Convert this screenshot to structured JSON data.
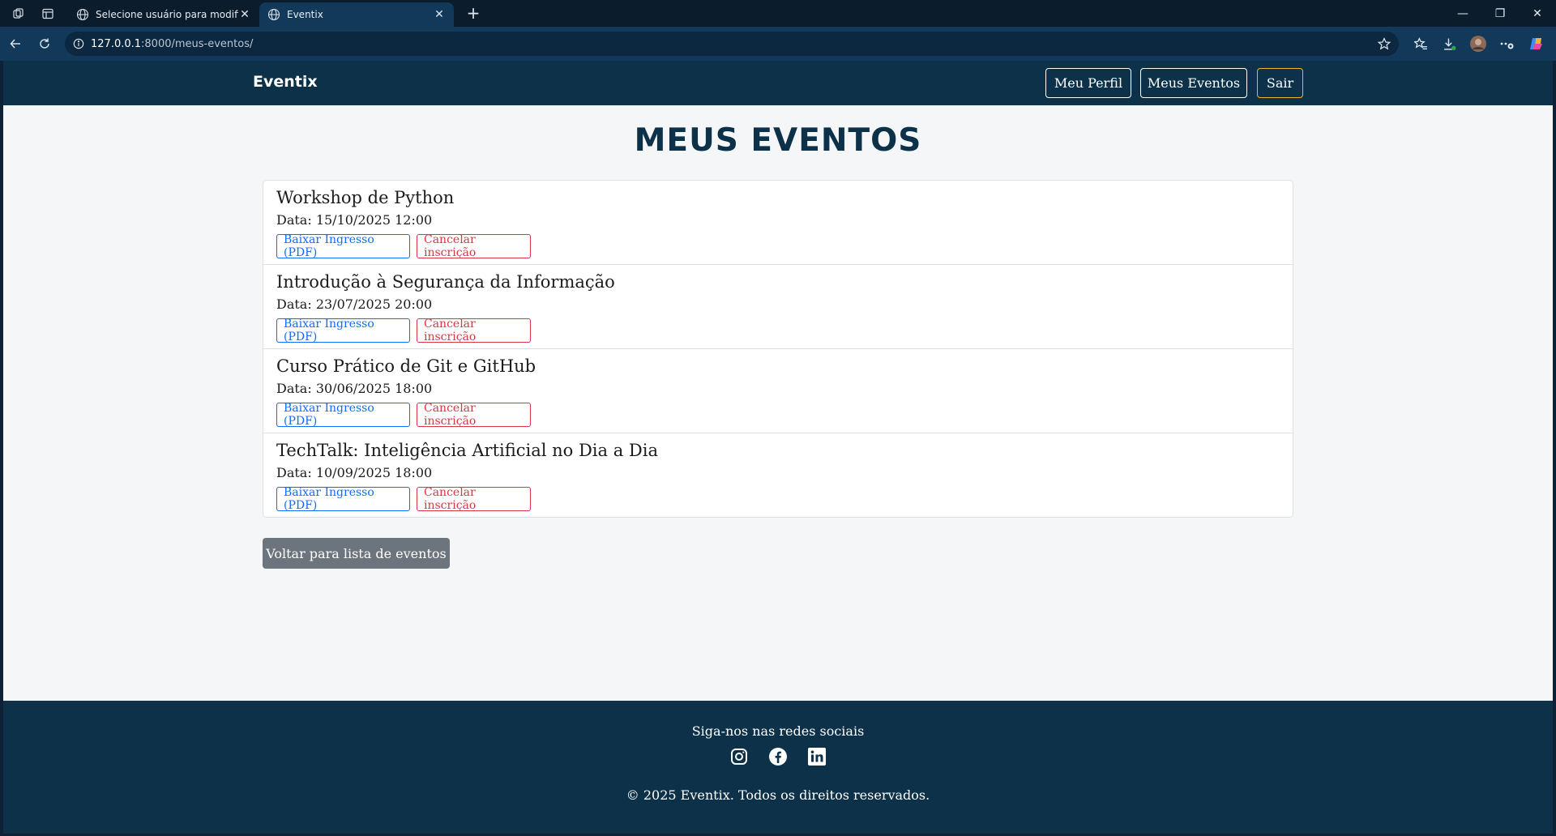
{
  "browser": {
    "tabs": [
      {
        "title": "Selecione usuário para modificar",
        "close": "✕"
      },
      {
        "title": "Eventix",
        "close": "✕"
      }
    ],
    "new_tab": "+",
    "url": {
      "host": "127.0.0.1",
      "rest": ":8000/meus-eventos/"
    },
    "window": {
      "minimize": "—",
      "restore": "❐",
      "close": "✕"
    }
  },
  "nav": {
    "brand": "Eventix",
    "links": [
      "Meu Perfil",
      "Meus Eventos",
      "Sair"
    ]
  },
  "page": {
    "title": "MEUS EVENTOS",
    "events": [
      {
        "title": "Workshop de Python",
        "date": "Data: 15/10/2025 12:00",
        "download": "Baixar Ingresso (PDF)",
        "cancel": "Cancelar inscrição"
      },
      {
        "title": "Introdução à Segurança da Informação",
        "date": "Data: 23/07/2025 20:00",
        "download": "Baixar Ingresso (PDF)",
        "cancel": "Cancelar inscrição"
      },
      {
        "title": "Curso Prático de Git e GitHub",
        "date": "Data: 30/06/2025 18:00",
        "download": "Baixar Ingresso (PDF)",
        "cancel": "Cancelar inscrição"
      },
      {
        "title": "TechTalk: Inteligência Artificial no Dia a Dia",
        "date": "Data: 10/09/2025 18:00",
        "download": "Baixar Ingresso (PDF)",
        "cancel": "Cancelar inscrição"
      }
    ],
    "back_button": "Voltar para lista de eventos"
  },
  "footer": {
    "heading": "Siga-nos nas redes sociais",
    "social_icons": [
      "instagram-icon",
      "facebook-icon",
      "linkedin-icon"
    ],
    "copyright": "© 2025 Eventix. Todos os direitos reservados."
  },
  "colors": {
    "navbar": "#0d3149",
    "primary": "#0d6efd",
    "danger": "#dc3545",
    "secondary": "#6c757d",
    "warning": "#f0b429"
  }
}
